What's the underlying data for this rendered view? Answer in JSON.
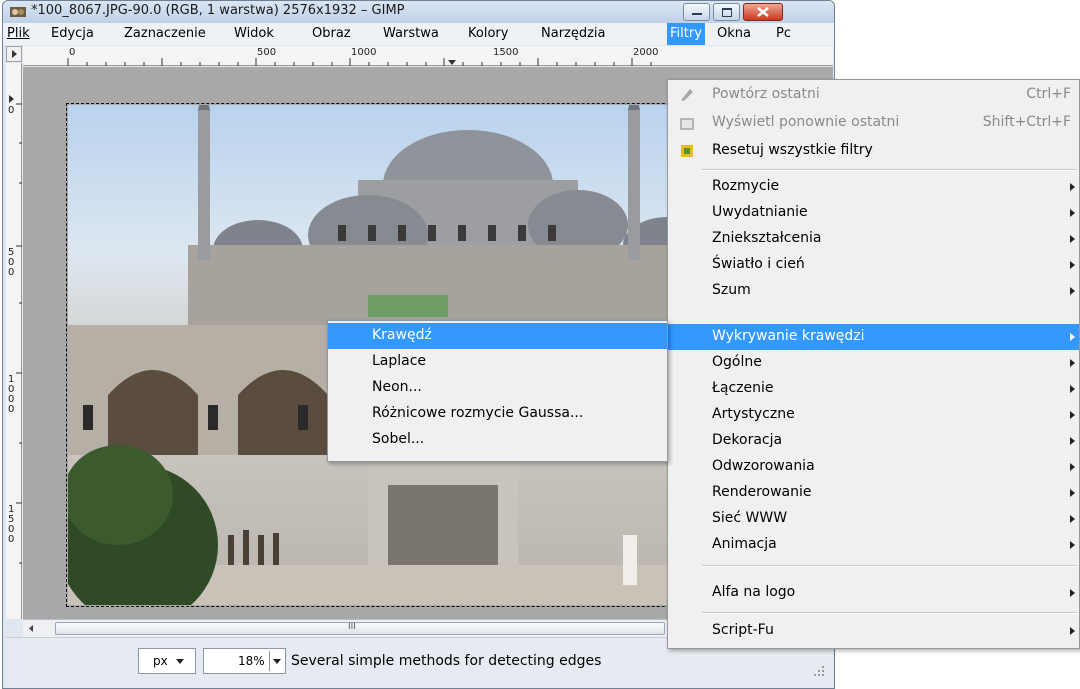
{
  "window": {
    "title": "*100_8067.JPG-90.0 (RGB, 1 warstwa) 2576x1932 – GIMP"
  },
  "menubar": {
    "items": [
      {
        "label": "Plik",
        "u": 0
      },
      {
        "label": "Edycja",
        "u": 0
      },
      {
        "label": "Zaznaczenie",
        "u": 0
      },
      {
        "label": "Widok",
        "u": 0
      },
      {
        "label": "Obraz",
        "u": 0
      },
      {
        "label": "Warstwa",
        "u": 0
      },
      {
        "label": "Kolory",
        "u": 0
      },
      {
        "label": "Narzędzia",
        "u": 0
      },
      {
        "label": "Filtry",
        "u": 0
      },
      {
        "label": "Okna",
        "u": 0
      },
      {
        "label": "Pc",
        "u": 0
      }
    ]
  },
  "ruler": {
    "h_labels": [
      "0",
      "500",
      "1000",
      "1500",
      "2000"
    ],
    "v_labels": [
      "0",
      "500",
      "1000",
      "1500"
    ]
  },
  "filters_menu": {
    "items": [
      {
        "label": "Powtórz ostatni",
        "shortcut": "Ctrl+F",
        "disabled": true,
        "icon": "repeat-icon"
      },
      {
        "label": "Wyświetl ponownie ostatni",
        "shortcut": "Shift+Ctrl+F",
        "disabled": true,
        "icon": "reshow-icon"
      },
      {
        "label": "Resetuj wszystkie filtry",
        "disabled": false,
        "icon": "reset-icon"
      },
      {
        "label": "Rozmycie",
        "submenu": true
      },
      {
        "label": "Uwydatnianie",
        "submenu": true
      },
      {
        "label": "Zniekształcenia",
        "submenu": true
      },
      {
        "label": "Światło i cień",
        "submenu": true
      },
      {
        "label": "Szum",
        "submenu": true
      },
      {
        "label": "Wykrywanie krawędzi",
        "submenu": true,
        "highlighted": true
      },
      {
        "label": "Ogólne",
        "submenu": true
      },
      {
        "label": "Łączenie",
        "submenu": true
      },
      {
        "label": "Artystyczne",
        "submenu": true
      },
      {
        "label": "Dekoracja",
        "submenu": true
      },
      {
        "label": "Odwzorowania",
        "submenu": true
      },
      {
        "label": "Renderowanie",
        "submenu": true
      },
      {
        "label": "Sieć WWW",
        "submenu": true
      },
      {
        "label": "Animacja",
        "submenu": true
      },
      {
        "label": "Alfa na logo",
        "submenu": true
      },
      {
        "label": "Script-Fu",
        "submenu": true
      }
    ]
  },
  "edge_submenu": {
    "items": [
      {
        "label": "Krawędź",
        "highlighted": true
      },
      {
        "label": "Laplace"
      },
      {
        "label": "Neon..."
      },
      {
        "label": "Różnicowe rozmycie Gaussa..."
      },
      {
        "label": "Sobel..."
      }
    ]
  },
  "statusbar": {
    "unit": "px",
    "zoom": "18%",
    "message": "Several simple methods for detecting edges"
  },
  "scrollbar": {
    "thumb_glyph": "III"
  }
}
